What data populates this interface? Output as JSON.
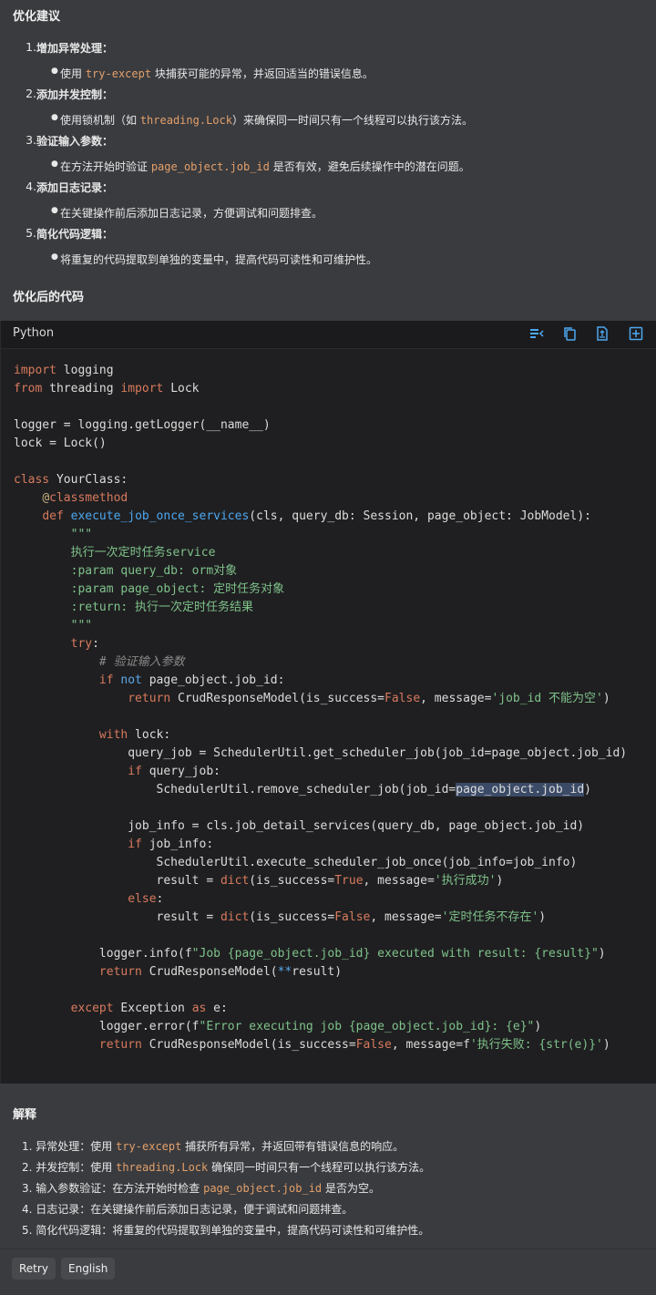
{
  "sections": {
    "suggestions_title": "优化建议",
    "optimized_code_title": "优化后的代码",
    "explain_title": "解释"
  },
  "suggestions": [
    {
      "num": "1.",
      "title": "增加异常处理：",
      "bullet_pre": "使用 ",
      "bullet_code": "try-except",
      "bullet_post": " 块捕获可能的异常，并返回适当的错误信息。"
    },
    {
      "num": "2.",
      "title": "添加并发控制：",
      "bullet_pre": "使用锁机制（如 ",
      "bullet_code": "threading.Lock",
      "bullet_post": "）来确保同一时间只有一个线程可以执行该方法。"
    },
    {
      "num": "3.",
      "title": "验证输入参数：",
      "bullet_pre": "在方法开始时验证 ",
      "bullet_code": "page_object.job_id",
      "bullet_post": " 是否有效，避免后续操作中的潜在问题。"
    },
    {
      "num": "4.",
      "title": "添加日志记录：",
      "bullet_pre": "在关键操作前后添加日志记录，方便调试和问题排查。",
      "bullet_code": "",
      "bullet_post": ""
    },
    {
      "num": "5.",
      "title": "简化代码逻辑：",
      "bullet_pre": "将重复的代码提取到单独的变量中，提高代码可读性和可维护性。",
      "bullet_code": "",
      "bullet_post": ""
    }
  ],
  "code": {
    "language": "Python",
    "toolbar_icons": [
      "wrap-icon",
      "copy-icon",
      "export-icon",
      "insert-icon"
    ]
  },
  "explain": [
    {
      "num": "1.",
      "pre": "异常处理：使用 ",
      "code": "try-except",
      "post": " 捕获所有异常，并返回带有错误信息的响应。"
    },
    {
      "num": "2.",
      "pre": "并发控制：使用 ",
      "code": "threading.Lock",
      "post": " 确保同一时间只有一个线程可以执行该方法。"
    },
    {
      "num": "3.",
      "pre": "输入参数验证：在方法开始时检查 ",
      "code": "page_object.job_id",
      "post": " 是否为空。"
    },
    {
      "num": "4.",
      "pre": "日志记录：在关键操作前后添加日志记录，便于调试和问题排查。",
      "code": "",
      "post": ""
    },
    {
      "num": "5.",
      "pre": "简化代码逻辑：将重复的代码提取到单独的变量中，提高代码可读性和可维护性。",
      "code": "",
      "post": ""
    }
  ],
  "buttons": {
    "retry": "Retry",
    "english": "English"
  }
}
